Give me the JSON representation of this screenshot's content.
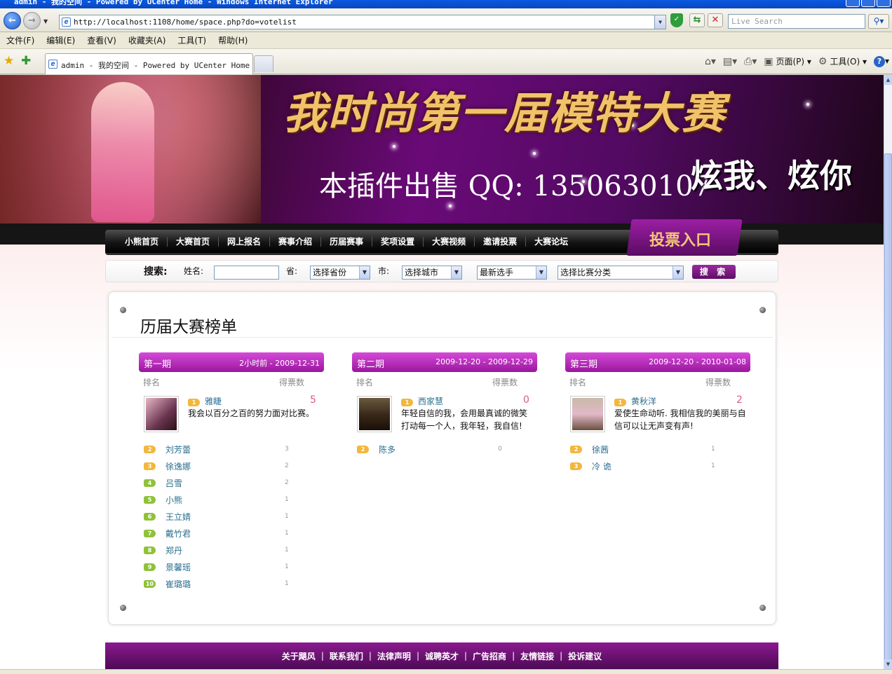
{
  "window": {
    "title": "admin - 我的空间 - Powered by UCenter Home - Windows Internet Explorer"
  },
  "browser": {
    "url": "http://localhost:1108/home/space.php?do=votelist",
    "search_placeholder": "Live Search",
    "menu": [
      "文件(F)",
      "编辑(E)",
      "查看(V)",
      "收藏夹(A)",
      "工具(T)",
      "帮助(H)"
    ],
    "tab_title": "admin - 我的空间 - Powered by UCenter Home",
    "cmd": {
      "page": "页面(P)",
      "tools": "工具(O)"
    }
  },
  "banner": {
    "title": "我时尚第一届模特大赛",
    "slogan": "炫我、炫你",
    "sale": "本插件出售 QQ: 1350630107"
  },
  "nav": {
    "items": [
      "小熊首页",
      "大赛首页",
      "网上报名",
      "赛事介绍",
      "历届赛事",
      "奖项设置",
      "大赛视频",
      "邀请投票",
      "大赛论坛"
    ],
    "vote_entry": "投票入口"
  },
  "search": {
    "title": "搜索:",
    "name_label": "姓名:",
    "province_label": "省:",
    "province_select": "选择省份",
    "city_label": "市:",
    "city_select": "选择城市",
    "sort_select": "最新选手",
    "category_select": "选择比赛分类",
    "button": "搜 索"
  },
  "board": {
    "title": "历届大赛榜单",
    "rank_header": "排名",
    "votes_header": "得票数",
    "periods": [
      {
        "name": "第一期",
        "dates": "2小时前 - 2009-12-31",
        "winner": {
          "name": "雅睫",
          "votes": "5",
          "motto": "我会以百分之百的努力面对比赛。"
        },
        "others": [
          {
            "rank": "2",
            "name": "刘芳蕾",
            "votes": "3"
          },
          {
            "rank": "3",
            "name": "徐逸娜",
            "votes": "2"
          },
          {
            "rank": "4",
            "name": "吕雪",
            "votes": "2"
          },
          {
            "rank": "5",
            "name": "小熊",
            "votes": "1"
          },
          {
            "rank": "6",
            "name": "王立婧",
            "votes": "1"
          },
          {
            "rank": "7",
            "name": "戴竹君",
            "votes": "1"
          },
          {
            "rank": "8",
            "name": "郑丹",
            "votes": "1"
          },
          {
            "rank": "9",
            "name": "景馨瑶",
            "votes": "1"
          },
          {
            "rank": "10",
            "name": "崔璐璐",
            "votes": "1"
          }
        ]
      },
      {
        "name": "第二期",
        "dates": "2009-12-20 - 2009-12-29",
        "winner": {
          "name": "西家慧",
          "votes": "0",
          "motto": "年轻自信的我，会用最真诚的微笑打动每一个人，我年轻，我自信!"
        },
        "others": [
          {
            "rank": "2",
            "name": "陈多",
            "votes": "0"
          }
        ]
      },
      {
        "name": "第三期",
        "dates": "2009-12-20 - 2010-01-08",
        "winner": {
          "name": "黄秋洋",
          "votes": "2",
          "motto": "爱使生命动听. 我相信我的美丽与自信可以让无声变有声!"
        },
        "others": [
          {
            "rank": "2",
            "name": "徐茜",
            "votes": "1"
          },
          {
            "rank": "3",
            "name": "冷 诡",
            "votes": "1"
          }
        ]
      }
    ]
  },
  "footer": {
    "items": [
      "关于飓风",
      "联系我们",
      "法律声明",
      "诚聘英才",
      "广告招商",
      "友情链接",
      "投诉建议"
    ]
  }
}
